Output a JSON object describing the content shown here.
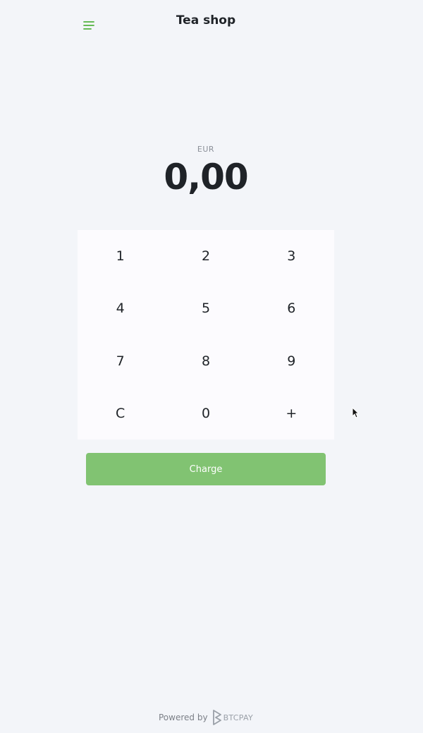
{
  "header": {
    "title": "Tea shop",
    "menu_icon": "hamburger-menu-icon"
  },
  "display": {
    "currency": "EUR",
    "amount": "0,00"
  },
  "keypad": {
    "keys": [
      "1",
      "2",
      "3",
      "4",
      "5",
      "6",
      "7",
      "8",
      "9",
      "C",
      "0",
      "+"
    ]
  },
  "actions": {
    "charge_label": "Charge"
  },
  "footer": {
    "powered_by": "Powered by",
    "brand": "BTCPAY",
    "logo_icon": "btcpay-logo-icon"
  },
  "colors": {
    "accent": "#51b13e",
    "charge_button": "#81c372",
    "background": "#f3f5f9",
    "keypad_background": "#fcfbfe"
  }
}
